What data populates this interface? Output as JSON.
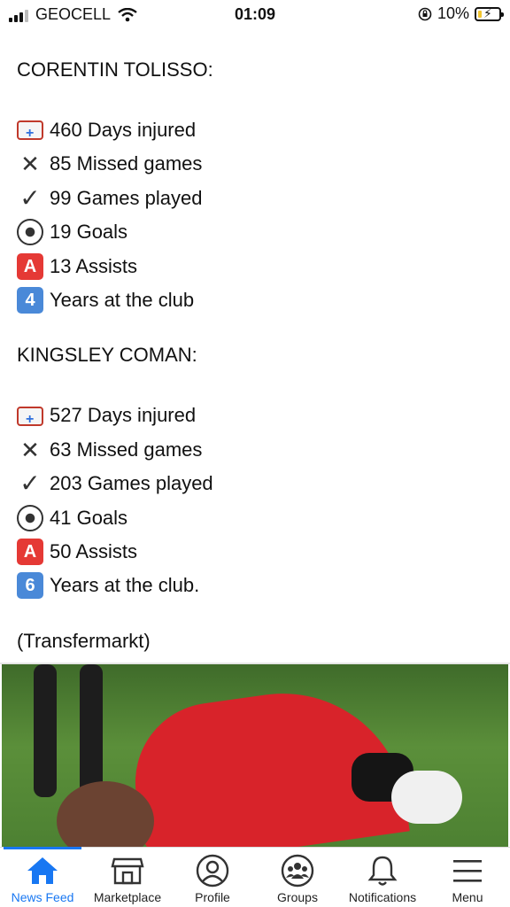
{
  "status_bar": {
    "carrier": "GEOCELL",
    "time": "01:09",
    "battery": "10%",
    "icons": [
      "signal-icon",
      "wifi-icon",
      "orientation-lock-icon",
      "battery-charging-icon"
    ]
  },
  "post": {
    "players": [
      {
        "name": "CORENTIN TOLISSO:",
        "stats": [
          {
            "icon": "ambulance-icon",
            "text": "460 Days injured"
          },
          {
            "icon": "cross-mark-icon",
            "text": "85 Missed games"
          },
          {
            "icon": "check-mark-icon",
            "text": "99 Games played"
          },
          {
            "icon": "soccer-ball-icon",
            "text": "19 Goals"
          },
          {
            "icon": "letter-a-icon",
            "glyph": "A",
            "text": "13 Assists"
          },
          {
            "icon": "keycap-4-icon",
            "glyph": "4",
            "text": "Years at the club"
          }
        ]
      },
      {
        "name": "KINGSLEY COMAN:",
        "stats": [
          {
            "icon": "ambulance-icon",
            "text": "527 Days injured"
          },
          {
            "icon": "cross-mark-icon",
            "text": "63 Missed games"
          },
          {
            "icon": "check-mark-icon",
            "text": "203 Games played"
          },
          {
            "icon": "soccer-ball-icon",
            "text": "41 Goals"
          },
          {
            "icon": "letter-a-icon",
            "glyph": "A",
            "text": "50 Assists"
          },
          {
            "icon": "keycap-6-icon",
            "glyph": "6",
            "text": "Years at the club."
          }
        ]
      }
    ],
    "source": "(Transfermarkt)"
  },
  "tabs": [
    {
      "label": "News Feed",
      "icon": "home-icon",
      "active": true
    },
    {
      "label": "Marketplace",
      "icon": "storefront-icon",
      "active": false
    },
    {
      "label": "Profile",
      "icon": "profile-icon",
      "active": false
    },
    {
      "label": "Groups",
      "icon": "groups-icon",
      "active": false
    },
    {
      "label": "Notifications",
      "icon": "bell-icon",
      "active": false
    },
    {
      "label": "Menu",
      "icon": "hamburger-menu-icon",
      "active": false
    }
  ],
  "colors": {
    "accent": "#1877f2",
    "battery_fill": "#f2c530"
  }
}
